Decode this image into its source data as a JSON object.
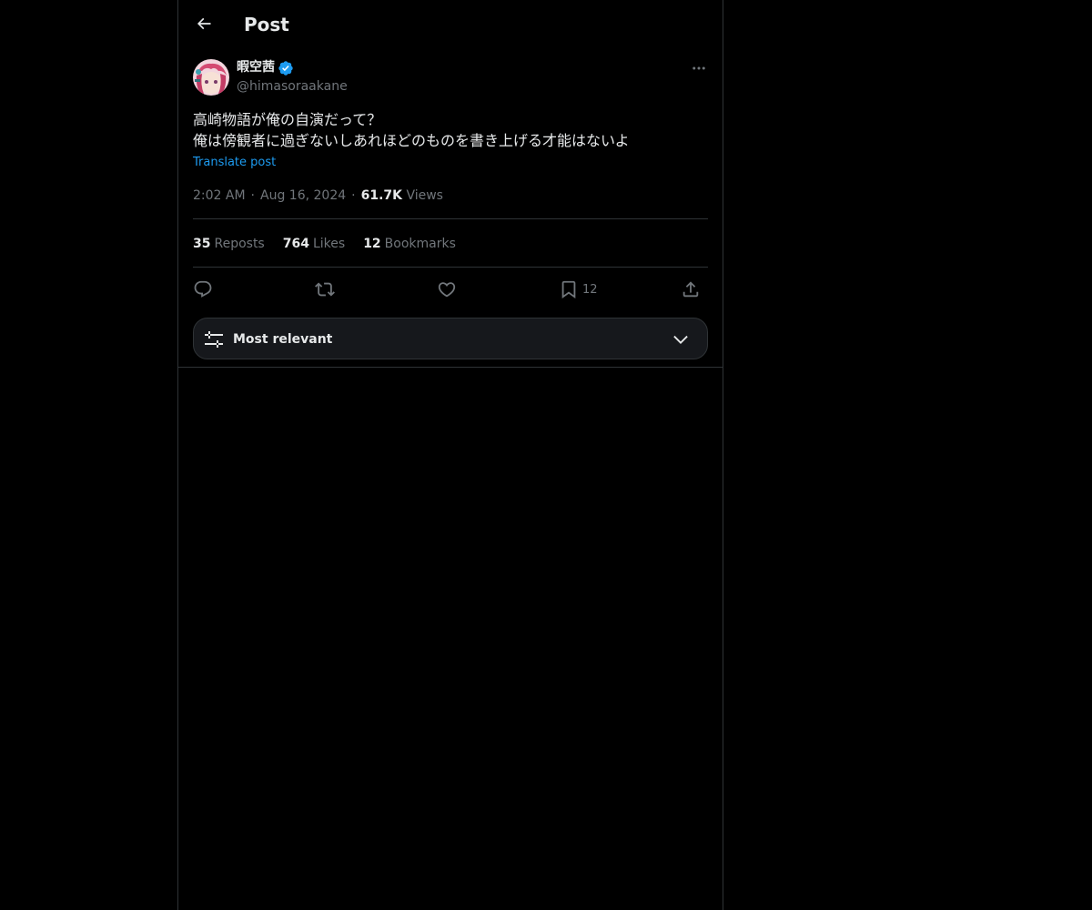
{
  "header": {
    "title": "Post",
    "back_icon": "arrow-left-icon"
  },
  "author": {
    "display_name": "暇空茜",
    "handle": "@himasoraakane",
    "verified": true,
    "verified_color": "#1d9bf0"
  },
  "post": {
    "text": "高崎物語が俺の自演だって？\n俺は傍観者に過ぎないしあれほどのものを書き上げる才能はないよ",
    "translate_label": "Translate post",
    "time": "2:02 AM",
    "date": "Aug 16, 2024",
    "views_count": "61.7K",
    "views_label": "Views",
    "separator": "·"
  },
  "stats": {
    "reposts_count": "35",
    "reposts_label": "Reposts",
    "likes_count": "764",
    "likes_label": "Likes",
    "bookmarks_count": "12",
    "bookmarks_label": "Bookmarks"
  },
  "actions": {
    "reply_icon": "reply-icon",
    "repost_icon": "repost-icon",
    "like_icon": "heart-icon",
    "bookmark_icon": "bookmark-icon",
    "bookmark_count": "12",
    "share_icon": "share-icon"
  },
  "sort": {
    "label": "Most relevant",
    "icon": "sliders-icon",
    "chevron": "chevron-down-icon"
  },
  "colors": {
    "background": "#000000",
    "text_primary": "#e7e9ea",
    "text_secondary": "#71767b",
    "accent": "#1d9bf0",
    "border": "#2f3336"
  }
}
